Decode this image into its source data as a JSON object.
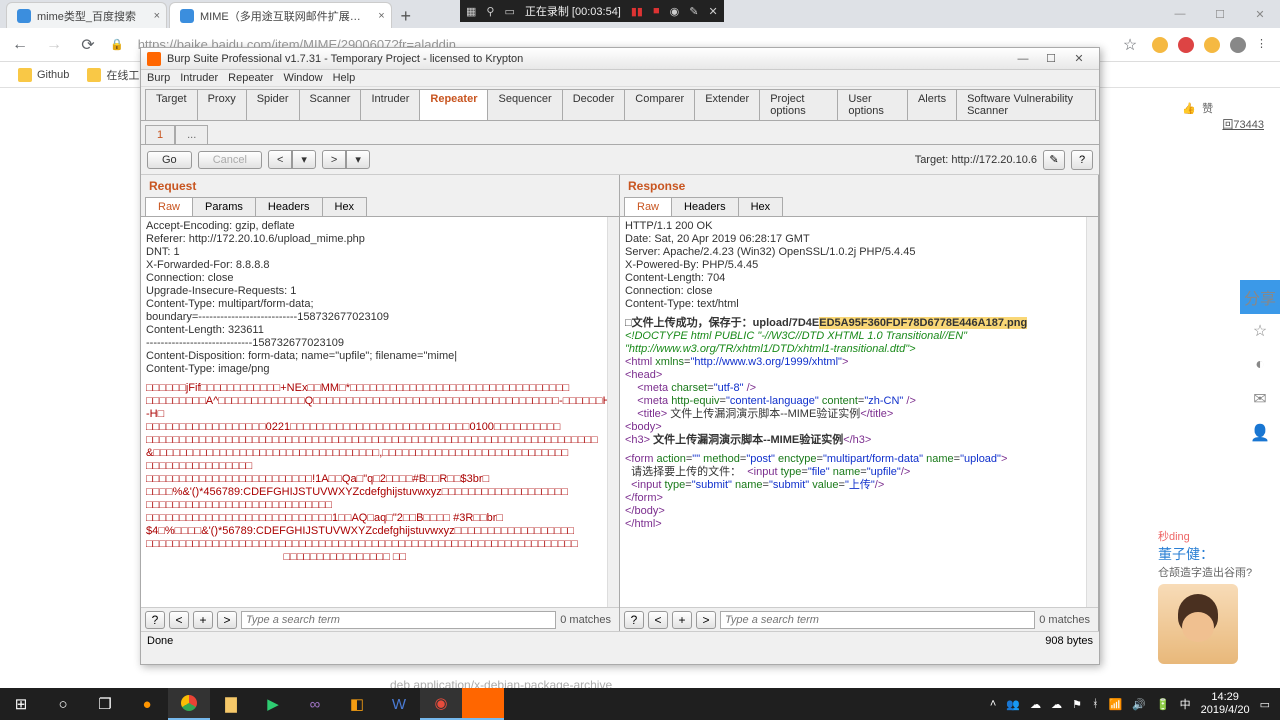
{
  "chrome": {
    "tabs": [
      {
        "title": "mime类型_百度搜索",
        "fav": "#3b8ede"
      },
      {
        "title": "MIME（多用途互联网邮件扩展…",
        "fav": "#3b8ede"
      }
    ],
    "url": "https://baike.baidu.com/item/MIME/2900607?fr=aladdin",
    "bookmarks": [
      "Github",
      "在线工…"
    ],
    "window_controls": [
      "—",
      "☐",
      "✕"
    ]
  },
  "recorder": {
    "text": "正在录制 [00:03:54]"
  },
  "right": {
    "like": "赞",
    "comments": "回73443",
    "share": "分享"
  },
  "promo": {
    "brand": "秒ding",
    "name": "董子健：",
    "line": "仓颉造字造出谷雨?"
  },
  "burp": {
    "title": "Burp Suite Professional v1.7.31 - Temporary Project - licensed to Krypton",
    "menu": [
      "Burp",
      "Intruder",
      "Repeater",
      "Window",
      "Help"
    ],
    "top_tabs": [
      "Target",
      "Proxy",
      "Spider",
      "Scanner",
      "Intruder",
      "Repeater",
      "Sequencer",
      "Decoder",
      "Comparer",
      "Extender",
      "Project options",
      "User options",
      "Alerts",
      "Software Vulnerability Scanner"
    ],
    "active_top": "Repeater",
    "sub_tab": "1",
    "sub_dots": "...",
    "go": "Go",
    "cancel": "Cancel",
    "target_line": "Target: http://172.20.10.6",
    "request_label": "Request",
    "response_label": "Response",
    "msg_tabs": [
      "Raw",
      "Params",
      "Headers",
      "Hex"
    ],
    "msg_tabs_resp": [
      "Raw",
      "Headers",
      "Hex"
    ],
    "request_headers": [
      "Accept-Encoding: gzip, deflate",
      "Referer: http://172.20.10.6/upload_mime.php",
      "DNT: 1",
      "X-Forwarded-For: 8.8.8.8",
      "Connection: close",
      "Upgrade-Insecure-Requests: 1",
      "Content-Type: multipart/form-data;",
      "boundary=---------------------------158732677023109",
      "Content-Length: 323611",
      "",
      "-----------------------------158732677023109",
      "Content-Disposition: form-data; name=\"upfile\"; filename=\"mime|",
      "Content-Type: image/png"
    ],
    "request_binary": [
      "□□□□□□jFif□□□□□□□□□□□□+NEx□□MM□*□□□□□□□□□□□□□□□□□□□□□□□□□□□□□□□□□",
      "□□□□□□□□□A^□□□□□□□□□□□□□Q□□□□□□□□□□□□□□□□□□□□□□□□□□□□□□□□□□□□□-□□□□□□H-H□",
      "□□□□□□□□□□□□□□□□□□0221□□□□□□□□□□□□□□□□□□□□□□□□□□□0100□□□□□□□□□□",
      "□□□□□□□□□□□□□□□□□□□□□□□□□□□□□□□□□□□□□□□□□□□□□□□□□□□□□□□□□□□□□□□□□□□□",
      "&□□□□□□□□□□□□□□□□□□□□□□□□□□□□□□□□□□,□□□□□□□□□□□□□□□□□□□□□□□□□□□□",
      "□□□□□□□□□□□□□□□□",
      "□□□□□□□□□□□□□□□□□□□□□□□□□!1A□□Qa□\"q□2□□□□#B□□R□□$3br□",
      "□□□□%&'()*456789:CDEFGHIJSTUVWXYZcdefghijstuvwxyz□□□□□□□□□□□□□□□□□□□",
      "□□□□□□□□□□□□□□□□□□□□□□□□□□□□",
      "□□□□□□□□□□□□□□□□□□□□□□□□□□□□1□□AQ□aq□\"2□□B□□□□ #3R□□br□",
      "$4□%□□□□&'()*56789:CDEFGHIJSTUVWXYZcdefghijstuvwxyz□□□□□□□□□□□□□□□□□□",
      "□□□□□□□□□□□□□□□□□□□□□□□□□□□□□□□□□□□□□□□□□□□□□□□□□□□□□□□□□□□□□□□□□",
      "                                             □□□□□□□□□□□□□□□□ □□"
    ],
    "response_headers": [
      "HTTP/1.1 200 OK",
      "Date: Sat, 20 Apr 2019 06:28:17 GMT",
      "Server: Apache/2.4.23 (Win32) OpenSSL/1.0.2j PHP/5.4.45",
      "X-Powered-By: PHP/5.4.45",
      "Content-Length: 704",
      "Connection: close",
      "Content-Type: text/html"
    ],
    "upload_prefix": "□文件上传成功，保存于：upload/7D4E",
    "upload_hl": "ED5A95F360FDF78D6778E446A187.png",
    "resp_body": {
      "doctype": "<!DOCTYPE html PUBLIC \"-//W3C//DTD XHTML 1.0 Transitional//EN\"",
      "dtd": "    \"http://www.w3.org/TR/xhtml1/DTD/xhtml1-transitional.dtd\">",
      "html_open": "<html xmlns=\"http://www.w3.org/1999/xhtml\">",
      "head_open": "<head>",
      "head_close": "</head>",
      "meta1": "    <meta charset=\"utf-8\" />",
      "meta2": "    <meta http-equiv=\"content-language\" content=\"zh-CN\" />",
      "title": "    <title> 文件上传漏洞演示脚本--MIME验证实例</title>",
      "body_open": "<body>",
      "h3": "<h3> 文件上传漏洞演示脚本--MIME验证实例</h3>",
      "form_open": "<form action=\"\" method=\"post\" enctype=\"multipart/form-data\" name=\"upload\">",
      "upfile": "  请选择要上传的文件：  <input type=\"file\" name=\"upfile\"/>",
      "submit": "  <input type=\"submit\" name=\"submit\" value=\"上传\"/>",
      "form_close": "</form>",
      "body_close": "</body>",
      "html_close": "</html>"
    },
    "search_placeholder": "Type a search term",
    "matches": "0 matches",
    "status_done": "Done",
    "status_bytes": "908 bytes"
  },
  "footer_hint": "deb application/x-debian-package-archive",
  "taskbar": {
    "time": "14:29",
    "date": "2019/4/20"
  }
}
